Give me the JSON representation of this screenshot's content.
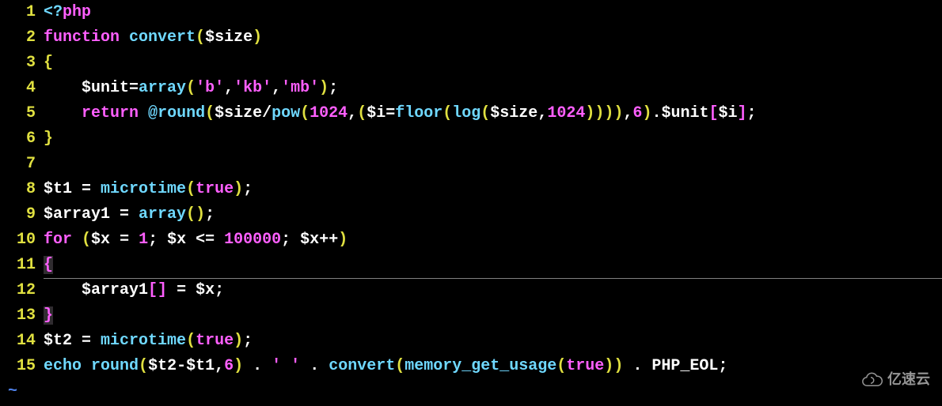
{
  "lines": [
    {
      "num": "1",
      "tokens": [
        {
          "t": "<?",
          "c": "c-fname"
        },
        {
          "t": "php",
          "c": "c-keyword"
        }
      ]
    },
    {
      "num": "2",
      "tokens": [
        {
          "t": "function",
          "c": "c-keyword"
        },
        {
          "t": " "
        },
        {
          "t": "convert",
          "c": "c-fname"
        },
        {
          "t": "(",
          "c": "c-paren"
        },
        {
          "t": "$size",
          "c": "c-var"
        },
        {
          "t": ")",
          "c": "c-paren"
        }
      ]
    },
    {
      "num": "3",
      "tokens": [
        {
          "t": "{",
          "c": "c-brace"
        }
      ]
    },
    {
      "num": "4",
      "tokens": [
        {
          "t": "    "
        },
        {
          "t": "$unit",
          "c": "c-var"
        },
        {
          "t": "=",
          "c": "c-op"
        },
        {
          "t": "array",
          "c": "c-fname"
        },
        {
          "t": "(",
          "c": "c-paren"
        },
        {
          "t": "'b'",
          "c": "c-string"
        },
        {
          "t": ",",
          "c": "c-punc"
        },
        {
          "t": "'kb'",
          "c": "c-string"
        },
        {
          "t": ",",
          "c": "c-punc"
        },
        {
          "t": "'mb'",
          "c": "c-string"
        },
        {
          "t": ")",
          "c": "c-paren"
        },
        {
          "t": ";",
          "c": "c-punc"
        }
      ]
    },
    {
      "num": "5",
      "tokens": [
        {
          "t": "    "
        },
        {
          "t": "return",
          "c": "c-keyword"
        },
        {
          "t": " "
        },
        {
          "t": "@",
          "c": "c-fname"
        },
        {
          "t": "round",
          "c": "c-fname"
        },
        {
          "t": "(",
          "c": "c-paren"
        },
        {
          "t": "$size",
          "c": "c-var"
        },
        {
          "t": "/",
          "c": "c-op"
        },
        {
          "t": "pow",
          "c": "c-fname"
        },
        {
          "t": "(",
          "c": "c-paren"
        },
        {
          "t": "1024",
          "c": "c-number"
        },
        {
          "t": ",",
          "c": "c-punc"
        },
        {
          "t": "(",
          "c": "c-paren"
        },
        {
          "t": "$i",
          "c": "c-var"
        },
        {
          "t": "=",
          "c": "c-op"
        },
        {
          "t": "floor",
          "c": "c-fname"
        },
        {
          "t": "(",
          "c": "c-paren"
        },
        {
          "t": "log",
          "c": "c-fname"
        },
        {
          "t": "(",
          "c": "c-paren"
        },
        {
          "t": "$size",
          "c": "c-var"
        },
        {
          "t": ",",
          "c": "c-punc"
        },
        {
          "t": "1024",
          "c": "c-number"
        },
        {
          "t": ")",
          "c": "c-paren"
        },
        {
          "t": ")",
          "c": "c-paren"
        },
        {
          "t": ")",
          "c": "c-paren"
        },
        {
          "t": ")",
          "c": "c-paren"
        },
        {
          "t": ",",
          "c": "c-punc"
        },
        {
          "t": "6",
          "c": "c-number"
        },
        {
          "t": ")",
          "c": "c-paren"
        },
        {
          "t": ".",
          "c": "c-op"
        },
        {
          "t": "$unit",
          "c": "c-var"
        },
        {
          "t": "[",
          "c": "c-bracket"
        },
        {
          "t": "$i",
          "c": "c-var"
        },
        {
          "t": "]",
          "c": "c-bracket"
        },
        {
          "t": ";",
          "c": "c-punc"
        }
      ]
    },
    {
      "num": "6",
      "tokens": [
        {
          "t": "}",
          "c": "c-brace"
        }
      ]
    },
    {
      "num": "7",
      "tokens": []
    },
    {
      "num": "8",
      "tokens": [
        {
          "t": "$t1",
          "c": "c-var"
        },
        {
          "t": " = ",
          "c": "c-op"
        },
        {
          "t": "microtime",
          "c": "c-fname"
        },
        {
          "t": "(",
          "c": "c-paren"
        },
        {
          "t": "true",
          "c": "c-bool"
        },
        {
          "t": ")",
          "c": "c-paren"
        },
        {
          "t": ";",
          "c": "c-punc"
        }
      ]
    },
    {
      "num": "9",
      "tokens": [
        {
          "t": "$array1",
          "c": "c-var"
        },
        {
          "t": " = ",
          "c": "c-op"
        },
        {
          "t": "array",
          "c": "c-fname"
        },
        {
          "t": "(",
          "c": "c-paren"
        },
        {
          "t": ")",
          "c": "c-paren"
        },
        {
          "t": ";",
          "c": "c-punc"
        }
      ]
    },
    {
      "num": "10",
      "tokens": [
        {
          "t": "for",
          "c": "c-keyword"
        },
        {
          "t": " "
        },
        {
          "t": "(",
          "c": "c-paren"
        },
        {
          "t": "$x",
          "c": "c-var"
        },
        {
          "t": " = ",
          "c": "c-op"
        },
        {
          "t": "1",
          "c": "c-number"
        },
        {
          "t": "; ",
          "c": "c-punc"
        },
        {
          "t": "$x",
          "c": "c-var"
        },
        {
          "t": " <= ",
          "c": "c-op"
        },
        {
          "t": "100000",
          "c": "c-number"
        },
        {
          "t": "; ",
          "c": "c-punc"
        },
        {
          "t": "$x",
          "c": "c-var"
        },
        {
          "t": "++",
          "c": "c-op"
        },
        {
          "t": ")",
          "c": "c-paren"
        }
      ]
    },
    {
      "num": "11",
      "tokens": [
        {
          "t": "{",
          "c": "c-brace-hl"
        }
      ]
    },
    {
      "num": "12",
      "tokens": [
        {
          "t": "    "
        },
        {
          "t": "$array1",
          "c": "c-var"
        },
        {
          "t": "[",
          "c": "c-bracket"
        },
        {
          "t": "]",
          "c": "c-bracket"
        },
        {
          "t": " = ",
          "c": "c-op"
        },
        {
          "t": "$x",
          "c": "c-var"
        },
        {
          "t": ";",
          "c": "c-punc"
        }
      ]
    },
    {
      "num": "13",
      "tokens": [
        {
          "t": "}",
          "c": "c-brace-hl"
        }
      ]
    },
    {
      "num": "14",
      "tokens": [
        {
          "t": "$t2",
          "c": "c-var"
        },
        {
          "t": " = ",
          "c": "c-op"
        },
        {
          "t": "microtime",
          "c": "c-fname"
        },
        {
          "t": "(",
          "c": "c-paren"
        },
        {
          "t": "true",
          "c": "c-bool"
        },
        {
          "t": ")",
          "c": "c-paren"
        },
        {
          "t": ";",
          "c": "c-punc"
        }
      ]
    },
    {
      "num": "15",
      "tokens": [
        {
          "t": "echo",
          "c": "c-fname"
        },
        {
          "t": " "
        },
        {
          "t": "round",
          "c": "c-fname"
        },
        {
          "t": "(",
          "c": "c-paren"
        },
        {
          "t": "$t2",
          "c": "c-var"
        },
        {
          "t": "-",
          "c": "c-op"
        },
        {
          "t": "$t1",
          "c": "c-var"
        },
        {
          "t": ",",
          "c": "c-punc"
        },
        {
          "t": "6",
          "c": "c-number"
        },
        {
          "t": ")",
          "c": "c-paren"
        },
        {
          "t": " . ",
          "c": "c-op"
        },
        {
          "t": "' '",
          "c": "c-string"
        },
        {
          "t": " . ",
          "c": "c-op"
        },
        {
          "t": "convert",
          "c": "c-fname"
        },
        {
          "t": "(",
          "c": "c-paren"
        },
        {
          "t": "memory_get_usage",
          "c": "c-fname"
        },
        {
          "t": "(",
          "c": "c-paren"
        },
        {
          "t": "true",
          "c": "c-bool"
        },
        {
          "t": ")",
          "c": "c-paren"
        },
        {
          "t": ")",
          "c": "c-paren"
        },
        {
          "t": " . ",
          "c": "c-op"
        },
        {
          "t": "PHP_EOL",
          "c": "c-const"
        },
        {
          "t": ";",
          "c": "c-punc"
        }
      ]
    }
  ],
  "tilde": "~",
  "watermark": "亿速云"
}
